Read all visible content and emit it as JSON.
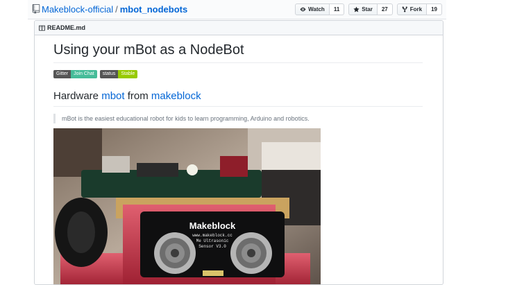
{
  "repo": {
    "owner": "Makeblock-official",
    "separator": "/",
    "name": "mbot_nodebots"
  },
  "actions": {
    "watch": {
      "label": "Watch",
      "count": "11"
    },
    "star": {
      "label": "Star",
      "count": "27"
    },
    "fork": {
      "label": "Fork",
      "count": "19"
    }
  },
  "readme": {
    "filename": "README.md",
    "title": "Using your mBot as a NodeBot",
    "badges": [
      {
        "left": "Gitter",
        "right": "Join Chat"
      },
      {
        "left": "status",
        "right": "Stable"
      }
    ],
    "heading": {
      "prefix": "Hardware ",
      "link1": "mbot",
      "middle": " from ",
      "link2": "makeblock"
    },
    "quote": "mBot is the easiest educational robot for kids to learn programming, Arduino and robotics.",
    "image_label": "Makeblock",
    "image_sublabel": "www.makeblock.cc",
    "image_sublabel2": "Me Ultrasonic",
    "image_sublabel3": "Sensor V3.0"
  },
  "colors": {
    "link": "#0366d6",
    "badge_dark": "#555555",
    "badge_green": "#46bc99",
    "badge_lime": "#97ca00",
    "robot_red": "#c8324a"
  }
}
